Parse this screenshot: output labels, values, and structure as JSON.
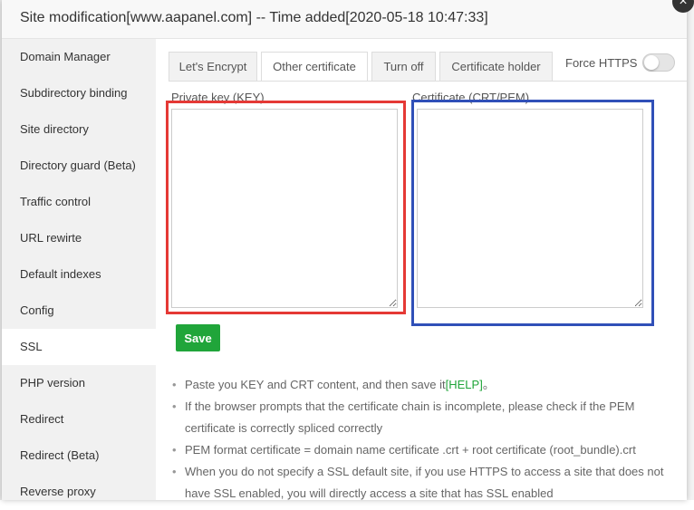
{
  "dialog": {
    "title": "Site modification[www.aapanel.com] -- Time added[2020-05-18 10:47:33]",
    "close_glyph": "×"
  },
  "sidebar": {
    "items": [
      {
        "label": "Domain Manager"
      },
      {
        "label": "Subdirectory binding"
      },
      {
        "label": "Site directory"
      },
      {
        "label": "Directory guard (Beta)"
      },
      {
        "label": "Traffic control"
      },
      {
        "label": "URL rewirte"
      },
      {
        "label": "Default indexes"
      },
      {
        "label": "Config"
      },
      {
        "label": "SSL",
        "active": true
      },
      {
        "label": "PHP version"
      },
      {
        "label": "Redirect"
      },
      {
        "label": "Redirect (Beta)"
      },
      {
        "label": "Reverse proxy"
      }
    ]
  },
  "tabs": [
    {
      "label": "Let's Encrypt"
    },
    {
      "label": "Other certificate",
      "active": true
    },
    {
      "label": "Turn off"
    },
    {
      "label": "Certificate holder"
    }
  ],
  "force_https": {
    "label": "Force HTTPS",
    "enabled": false
  },
  "form": {
    "private_key_label": "Private key (KEY)",
    "certificate_label": "Certificate (CRT/PEM)",
    "private_key_value": "",
    "certificate_value": "",
    "save_label": "Save"
  },
  "notes": {
    "note1_text": "Paste you KEY and CRT content, and then save it",
    "note1_link": "[HELP]",
    "note1_suffix": "。",
    "note2": "If the browser prompts that the certificate chain is incomplete, please check if the PEM certificate is correctly spliced correctly",
    "note3": "PEM format certificate = domain name certificate .crt + root certificate (root_bundle).crt",
    "note4": "When you do not specify a SSL default site, if you use HTTPS to access a site that does not have SSL enabled, you will directly access a site that has SSL enabled"
  },
  "colors": {
    "accent_green": "#20a53a",
    "highlight_red": "#e53935",
    "highlight_blue": "#3050b8"
  }
}
